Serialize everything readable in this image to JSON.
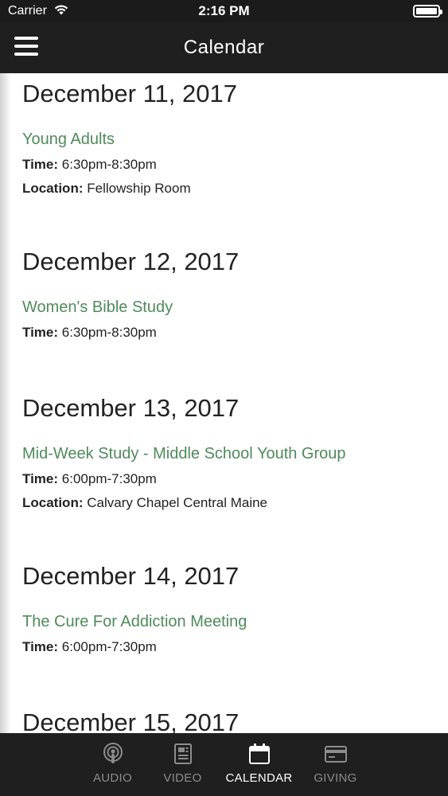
{
  "status_bar": {
    "carrier": "Carrier",
    "time": "2:16 PM"
  },
  "nav": {
    "title": "Calendar"
  },
  "days": [
    {
      "date": "December 11, 2017",
      "events": [
        {
          "title": "Young Adults",
          "time_label": "Time:",
          "time": "6:30pm-8:30pm",
          "location_label": "Location:",
          "location": "Fellowship Room"
        }
      ]
    },
    {
      "date": "December 12, 2017",
      "events": [
        {
          "title": "Women's Bible Study",
          "time_label": "Time:",
          "time": "6:30pm-8:30pm"
        }
      ]
    },
    {
      "date": "December 13, 2017",
      "events": [
        {
          "title": "Mid-Week Study - Middle School Youth Group",
          "time_label": "Time:",
          "time": "6:00pm-7:30pm",
          "location_label": "Location:",
          "location": "Calvary Chapel Central Maine"
        }
      ]
    },
    {
      "date": "December 14, 2017",
      "events": [
        {
          "title": "The Cure For Addiction Meeting",
          "time_label": "Time:",
          "time": "6:00pm-7:30pm"
        }
      ]
    },
    {
      "date": "December 15, 2017",
      "events": []
    }
  ],
  "tabs": [
    {
      "label": "AUDIO",
      "icon": "podcast-icon",
      "active": false
    },
    {
      "label": "VIDEO",
      "icon": "video-document-icon",
      "active": false
    },
    {
      "label": "CALENDAR",
      "icon": "calendar-icon",
      "active": true
    },
    {
      "label": "GIVING",
      "icon": "credit-card-icon",
      "active": false
    }
  ],
  "colors": {
    "event_title": "#4f8a5b",
    "bar_background": "#1f1f1f",
    "tab_inactive": "#8c8c8c",
    "tab_active": "#ffffff"
  }
}
